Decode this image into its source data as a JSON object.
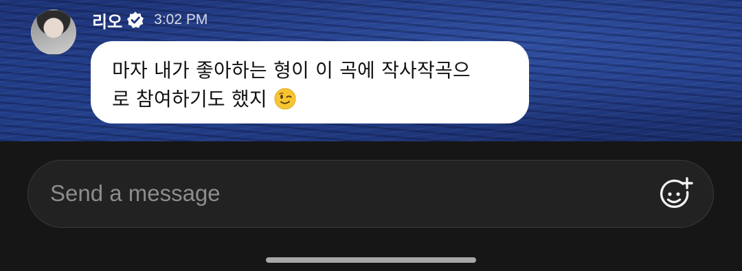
{
  "message": {
    "sender": "리오",
    "verified": true,
    "timestamp": "3:02 PM",
    "text_line1": "마자 내가 좋아하는 형이 이 곡에 작사작곡으",
    "text_line2": "로 참여하기도 했지",
    "emoji": "winking-face"
  },
  "composer": {
    "placeholder": "Send a message",
    "value": "",
    "sticker_icon": "smiley-plus-icon"
  },
  "colors": {
    "bubble": "#ffffff",
    "composer_bg": "#222222",
    "page_bg": "#161616",
    "water": "#223b86"
  }
}
